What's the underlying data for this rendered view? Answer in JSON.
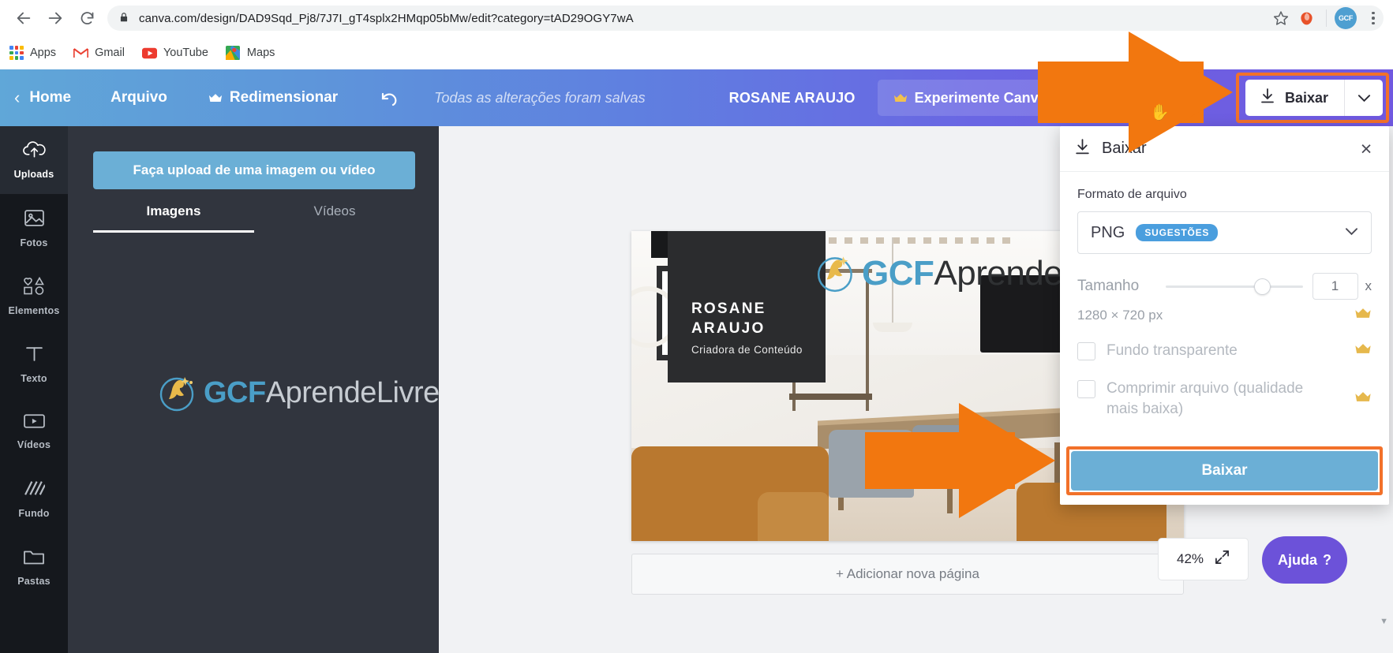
{
  "browser": {
    "url": "canva.com/design/DAD9Sqd_Pj8/7J7I_gT4splx2HMqp05bMw/edit?category=tAD29OGY7wA",
    "back_icon": "back-arrow-icon",
    "forward_icon": "forward-arrow-icon",
    "reload_icon": "reload-icon",
    "lock_icon": "lock-icon",
    "star_icon": "star-icon",
    "extension_icon": "extension-icon",
    "avatar_label": "GCF",
    "menu_icon": "kebab-menu-icon",
    "bookmarks": [
      {
        "label": "Apps",
        "icon": "apps-grid-icon"
      },
      {
        "label": "Gmail",
        "icon": "gmail-icon"
      },
      {
        "label": "YouTube",
        "icon": "youtube-icon"
      },
      {
        "label": "Maps",
        "icon": "maps-icon"
      }
    ]
  },
  "canva_header": {
    "home": "Home",
    "arquivo": "Arquivo",
    "redimensionar": "Redimensionar",
    "undo_icon": "undo-icon",
    "saved_status": "Todas as alterações foram salvas",
    "user_name": "ROSANE ARAUJO",
    "try_canva": "Experimente Canva Pro",
    "download_button": "Baixar",
    "download_icon": "download-icon",
    "caret_icon": "chevron-down-icon",
    "highlight_color": "#f2712a"
  },
  "rail": {
    "items": [
      {
        "label": "Uploads",
        "icon": "cloud-upload-icon",
        "active": true
      },
      {
        "label": "Fotos",
        "icon": "photo-icon",
        "active": false
      },
      {
        "label": "Elementos",
        "icon": "shapes-icon",
        "active": false
      },
      {
        "label": "Texto",
        "icon": "text-t-icon",
        "active": false
      },
      {
        "label": "Vídeos",
        "icon": "video-icon",
        "active": false
      },
      {
        "label": "Fundo",
        "icon": "background-hatch-icon",
        "active": false
      },
      {
        "label": "Pastas",
        "icon": "folder-icon",
        "active": false
      }
    ]
  },
  "uploads_panel": {
    "upload_button": "Faça upload de uma imagem ou vídeo",
    "tabs": [
      {
        "label": "Imagens",
        "active": true
      },
      {
        "label": "Vídeos",
        "active": false
      }
    ],
    "thumbnail": {
      "brand_bold": "GCF",
      "brand_light": "AprendeLivre",
      "registered": "®"
    },
    "collapse_icon": "chevron-left-icon"
  },
  "design": {
    "name_line1": "ROSANE",
    "name_line2": "ARAUJO",
    "subtitle": "Criadora de Conteúdo",
    "overlay_bold": "GCF",
    "overlay_light": "Aprende",
    "add_page": "+ Adicionar nova página",
    "zoom_level": "42%",
    "fit_icon": "expand-arrows-icon",
    "help_label": "Ajuda",
    "help_mark": "?"
  },
  "download_panel": {
    "title": "Baixar",
    "title_icon": "download-icon",
    "close_icon": "close-icon",
    "format_label": "Formato de arquivo",
    "format_value": "PNG",
    "format_badge": "SUGESTÕES",
    "format_caret": "chevron-down-icon",
    "size_label": "Tamanho",
    "size_multiplier": "1",
    "size_unit": "x",
    "dimensions": "1280 × 720 px",
    "crown_icon": "crown-icon",
    "checkbox_transparent": "Fundo transparente",
    "checkbox_compress": "Comprimir arquivo (qualidade mais baixa)",
    "action_button": "Baixar",
    "accent_color": "#6bafd6",
    "badge_color": "#4a9ede",
    "highlight_color": "#f2712a"
  },
  "annotations": {
    "arrow_color": "#f2770f",
    "arrow_1": "arrow-pointing-to-download-button",
    "arrow_2": "arrow-pointing-to-baixar-confirm"
  }
}
